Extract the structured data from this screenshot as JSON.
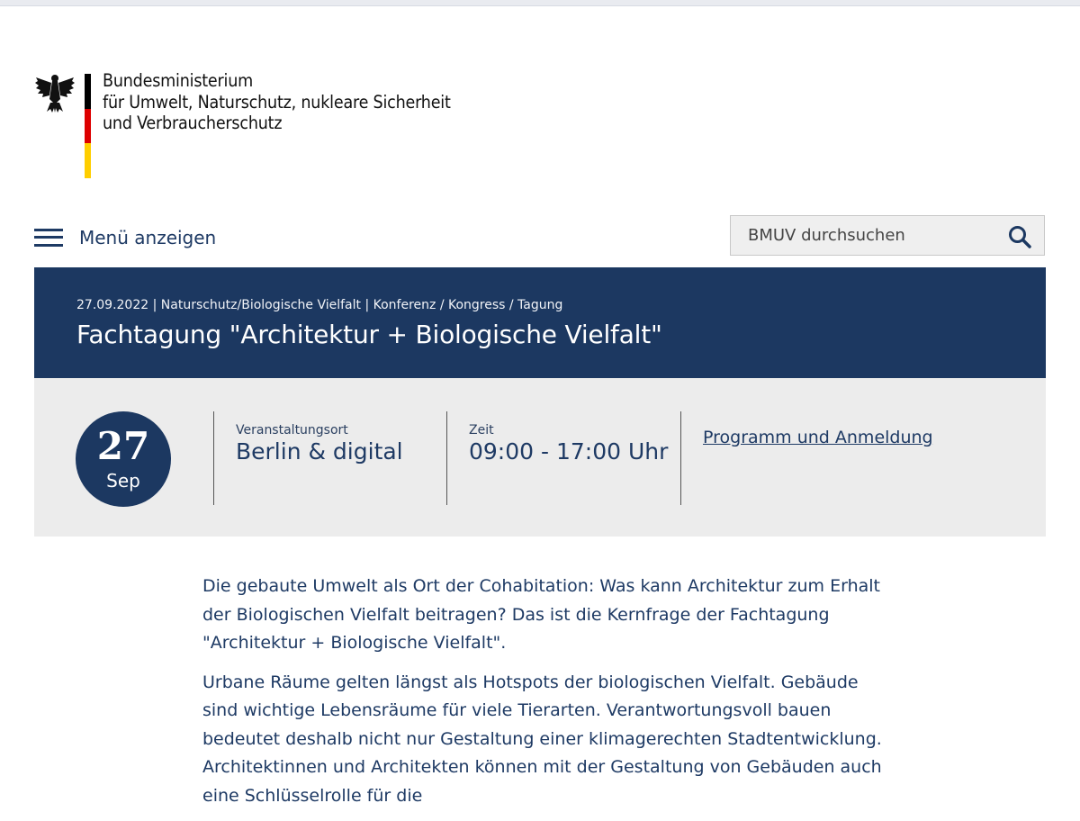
{
  "header": {
    "ministry_lines": [
      "Bundesministerium",
      "für Umwelt, Naturschutz, nukleare Sicherheit",
      "und Verbraucherschutz"
    ],
    "flag_colors": [
      "#000000",
      "#dd0000",
      "#ffce00"
    ]
  },
  "nav": {
    "menu_label": "Menü anzeigen",
    "search_placeholder": "BMUV durchsuchen"
  },
  "event": {
    "meta": "27.09.2022 | Naturschutz/Biologische Vielfalt | Konferenz / Kongress / Tagung",
    "title": "Fachtagung \"Architektur + Biologische Vielfalt\"",
    "date_day": "27",
    "date_month": "Sep",
    "location_label": "Veranstaltungsort",
    "location_value": "Berlin & digital",
    "time_label": "Zeit",
    "time_value": "09:00 - 17:00 Uhr",
    "link_label": "Programm und Anmeldung"
  },
  "content": {
    "paragraphs": [
      "Die gebaute Umwelt als Ort der Cohabitation: Was kann Architektur zum Erhalt der Biologischen Vielfalt beitragen? Das ist die Kernfrage der Fachtagung \"Architektur + Biologische Vielfalt\".",
      "Urbane Räume gelten längst als Hotspots der biologischen Vielfalt. Gebäude sind wichtige Lebensräume für viele Tierarten. Verantwortungsvoll bauen bedeutet deshalb nicht nur Gestaltung einer klimagerechten Stadtentwicklung. Architektinnen und Architekten können mit der Gestaltung von Gebäuden auch eine Schlüsselrolle für die"
    ]
  },
  "colors": {
    "brand_navy": "#1c3861",
    "info_background": "#ececec"
  },
  "icons": {
    "logo": "federal-eagle-icon",
    "menu": "hamburger-menu-icon",
    "search": "search-icon"
  }
}
